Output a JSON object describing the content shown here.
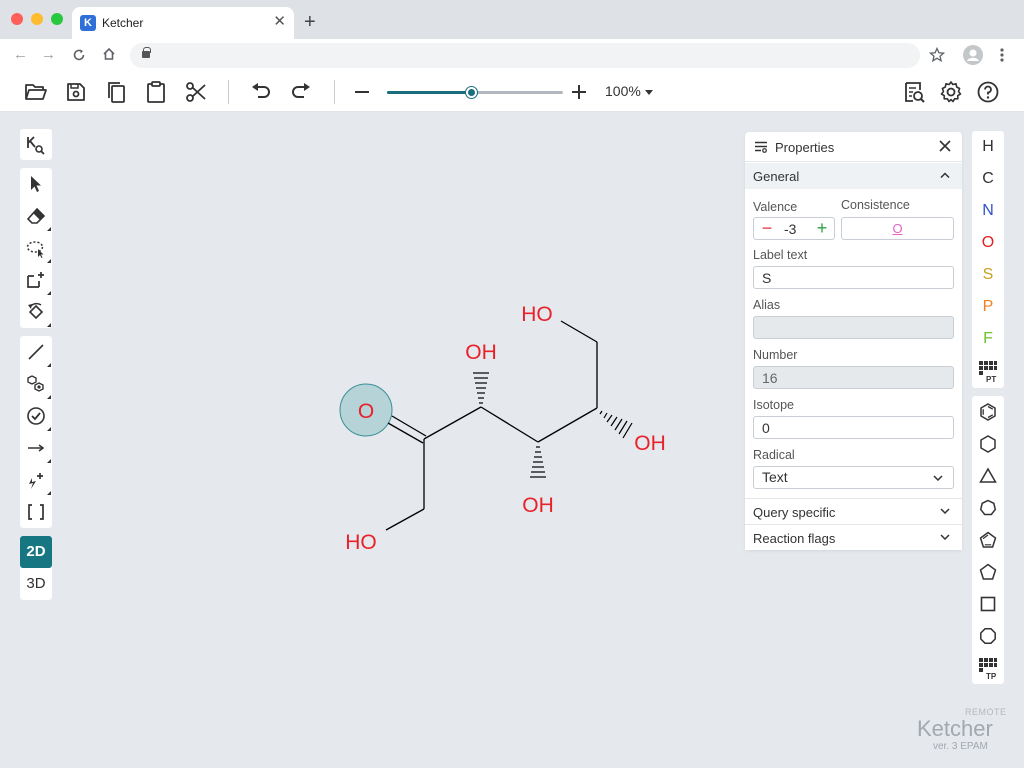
{
  "browser": {
    "tab_title": "Ketcher",
    "favicon_letter": "K",
    "url": ""
  },
  "toolbar": {
    "zoom_value": "100%",
    "zoom_fraction": 0.48
  },
  "left_toolbar": {
    "mode_2d": "2D",
    "mode_3d": "3D"
  },
  "elements": [
    {
      "symbol": "H",
      "color": "#333333"
    },
    {
      "symbol": "C",
      "color": "#333333"
    },
    {
      "symbol": "N",
      "color": "#3050c8"
    },
    {
      "symbol": "O",
      "color": "#e02020"
    },
    {
      "symbol": "S",
      "color": "#c8a020"
    },
    {
      "symbol": "P",
      "color": "#f08020"
    },
    {
      "symbol": "F",
      "color": "#70c030"
    }
  ],
  "periodic_table_label": "PT",
  "templates_label": "TP",
  "properties": {
    "title": "Properties",
    "general_label": "General",
    "valence_label": "Valence",
    "valence_value": "-3",
    "consistence_label": "Consistence",
    "consistence_value": "O",
    "label_text_label": "Label text",
    "label_text_value": "S",
    "alias_label": "Alias",
    "alias_value": "",
    "number_label": "Number",
    "number_value": "16",
    "isotope_label": "Isotope",
    "isotope_value": "0",
    "radical_label": "Radical",
    "radical_value": "Text",
    "query_specific_label": "Query specific",
    "reaction_flags_label": "Reaction flags"
  },
  "molecule": {
    "atom_labels": [
      "O",
      "HO",
      "OH",
      "HO",
      "OH",
      "OH"
    ],
    "selected_atom": "O"
  },
  "brand": {
    "remote": "REMOTE",
    "name": "Ketcher",
    "version": "ver. 3 EPAM"
  }
}
